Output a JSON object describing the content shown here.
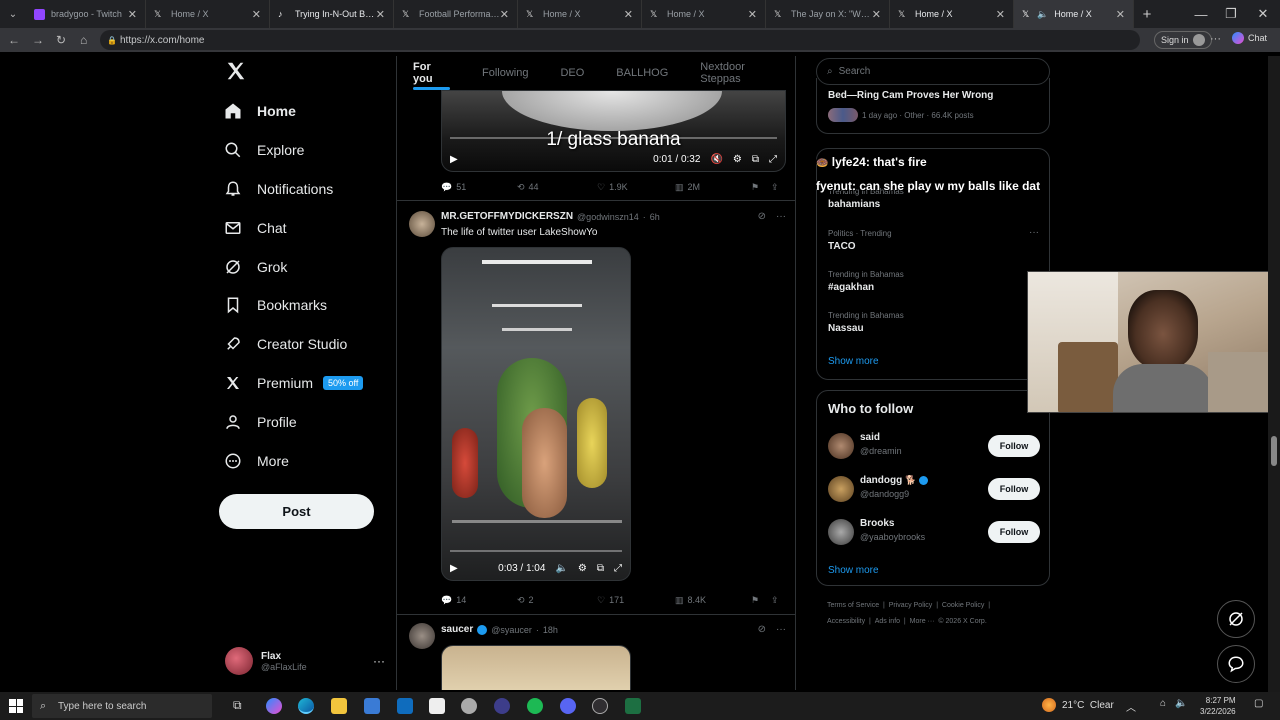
{
  "browser": {
    "tabs": [
      {
        "title": "bradygoo - Twitch",
        "active": false
      },
      {
        "title": "Home / X",
        "active": false
      },
      {
        "title": "Trying In-N-Out Burger",
        "active": false
      },
      {
        "title": "Football Performances",
        "active": false
      },
      {
        "title": "Home / X",
        "active": false
      },
      {
        "title": "Home / X",
        "active": false
      },
      {
        "title": "The Jay on X: \"WWE be",
        "active": false
      },
      {
        "title": "Home / X",
        "active": false
      },
      {
        "title": "Home / X",
        "active": true
      }
    ],
    "url": "https://x.com/home",
    "sign_in": "Sign in",
    "chat": "Chat"
  },
  "sidebar": {
    "items": [
      {
        "label": "Home",
        "icon": "home-icon"
      },
      {
        "label": "Explore",
        "icon": "search-icon"
      },
      {
        "label": "Notifications",
        "icon": "bell-icon"
      },
      {
        "label": "Chat",
        "icon": "mail-icon"
      },
      {
        "label": "Grok",
        "icon": "grok-icon"
      },
      {
        "label": "Bookmarks",
        "icon": "bookmark-icon"
      },
      {
        "label": "Creator Studio",
        "icon": "rocket-icon"
      },
      {
        "label": "Premium",
        "icon": "x-logo-icon"
      },
      {
        "label": "Profile",
        "icon": "person-icon"
      },
      {
        "label": "More",
        "icon": "more-circle-icon"
      }
    ],
    "premium_badge": "50% off",
    "post": "Post",
    "account": {
      "name": "Flax",
      "handle": "@aFlaxLife"
    }
  },
  "feed": {
    "tabs": [
      "For you",
      "Following",
      "DEO",
      "BALLHOG",
      "Nextdoor Steppas"
    ],
    "post1": {
      "caption_overlay": "1/ glass banana",
      "time": "0:01 / 0:32",
      "replies": "51",
      "reposts": "44",
      "likes": "1.9K",
      "views": "2M"
    },
    "post2": {
      "name": "MR.GETOFFMYDICKERSZN",
      "handle": "@godwinszn14",
      "time": "6h",
      "text": "The life of twitter user LakeShowYo",
      "video_time": "0:03 / 1:04",
      "replies": "14",
      "reposts": "2",
      "likes": "171",
      "views": "8.4K"
    },
    "post3": {
      "name": "saucer",
      "handle": "@syaucer",
      "time": "18h"
    }
  },
  "right": {
    "search_placeholder": "Search",
    "top_trend": {
      "title": "Bed—Ring Cam Proves Her Wrong",
      "meta": "1 day ago · Other · 66.4K posts"
    },
    "trends": [
      {
        "meta": "Trending in Bahamas",
        "name": "bahamians"
      },
      {
        "meta": "Politics · Trending",
        "name": "TACO"
      },
      {
        "meta": "Trending in Bahamas",
        "name": "#agakhan"
      },
      {
        "meta": "Trending in Bahamas",
        "name": "Nassau"
      }
    ],
    "show_more": "Show more",
    "who_to_follow_title": "Who to follow",
    "follow_label": "Follow",
    "suggestions": [
      {
        "name": "said",
        "handle": "@dreamin"
      },
      {
        "name": "dandogg",
        "handle": "@dandogg9"
      },
      {
        "name": "Brooks",
        "handle": "@yaaboybrooks"
      }
    ],
    "show_more_2": "Show more",
    "footer": [
      "Terms of Service",
      "Privacy Policy",
      "Cookie Policy",
      "Accessibility",
      "Ads info",
      "More ···",
      "© 2026 X Corp."
    ]
  },
  "overlay": {
    "chat1": "lyfe24: that's fire",
    "chat2": "fyenut: can she play w my balls like dat"
  },
  "taskbar": {
    "search_placeholder": "Type here to search",
    "weather": "21°C  Clear",
    "time": "8:27 PM",
    "date": "3/22/2026"
  }
}
